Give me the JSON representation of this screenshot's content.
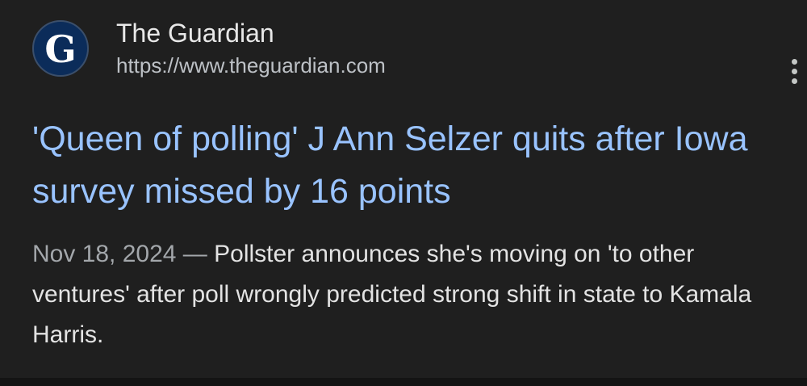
{
  "source": {
    "favicon_letter": "G",
    "name": "The Guardian",
    "url": "https://www.theguardian.com"
  },
  "menu": {
    "icon": "more-vert-icon"
  },
  "headline": "'Queen of polling' J Ann Selzer quits after Iowa survey missed by 16 points",
  "snippet": {
    "date": "Nov 18, 2024 — ",
    "text": "Pollster announces she's moving on 'to other ventures' after poll wrongly predicted strong shift in state to Kamala Harris."
  },
  "colors": {
    "background": "#1f1f1f",
    "headline_link": "#99c3ff",
    "favicon_bg": "#0b2c5a"
  }
}
